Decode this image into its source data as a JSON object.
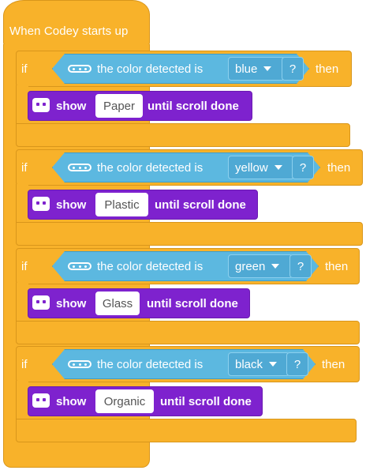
{
  "hat": {
    "label": "When Codey starts up"
  },
  "blocks": [
    {
      "if": "if",
      "cond": "the color detected is",
      "color": "blue",
      "q": "?",
      "then": "then",
      "show": "show",
      "value": "Paper",
      "suffix": "until scroll done"
    },
    {
      "if": "if",
      "cond": "the color detected is",
      "color": "yellow",
      "q": "?",
      "then": "then",
      "show": "show",
      "value": "Plastic",
      "suffix": "until scroll done"
    },
    {
      "if": "if",
      "cond": "the color detected is",
      "color": "green",
      "q": "?",
      "then": "then",
      "show": "show",
      "value": "Glass",
      "suffix": "until scroll done"
    },
    {
      "if": "if",
      "cond": "the color detected is",
      "color": "black",
      "q": "?",
      "then": "then",
      "show": "show",
      "value": "Organic",
      "suffix": "until scroll done"
    }
  ],
  "colors": {
    "event": "#F8B22A",
    "sensing": "#5CB8E0",
    "display": "#7E22CE"
  },
  "icons": {
    "condition": "color-sensor-icon",
    "show": "display-icon",
    "dropdown": "caret-down-icon"
  }
}
